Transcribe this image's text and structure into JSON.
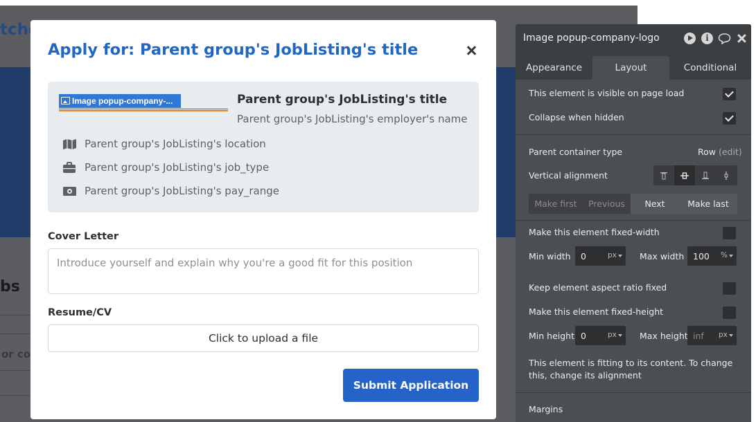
{
  "background": {
    "heading_fragment": "tche",
    "section_fragment": "bs",
    "search_fragment": "or co"
  },
  "modal": {
    "title": "Apply for: Parent group's JobListing's title",
    "logo_element_tag": "Image popup-company-...",
    "job_title": "Parent group's JobListing's title",
    "employer": "Parent group's JobListing's employer's name",
    "details": [
      {
        "icon": "map-icon",
        "text": "Parent group's JobListing's location"
      },
      {
        "icon": "briefcase-icon",
        "text": "Parent group's JobListing's job_type"
      },
      {
        "icon": "money-icon",
        "text": "Parent group's JobListing's pay_range"
      }
    ],
    "cover_letter": {
      "label": "Cover Letter",
      "placeholder": "Introduce yourself and explain why you're a good fit for this position",
      "value": ""
    },
    "resume": {
      "label": "Resume/CV",
      "upload_text": "Click to upload a file"
    },
    "submit_label": "Submit Application"
  },
  "panel": {
    "title": "Image popup-company-logo",
    "tabs": [
      "Appearance",
      "Layout",
      "Conditional"
    ],
    "active_tab": "Layout",
    "visible_on_load": {
      "label": "This element is visible on page load",
      "checked": true
    },
    "collapse_hidden": {
      "label": "Collapse when hidden",
      "checked": true
    },
    "container_type": {
      "label": "Parent container type",
      "value": "Row",
      "edit": "(edit)"
    },
    "vertical_alignment": {
      "label": "Vertical alignment",
      "selected": "center"
    },
    "order_buttons": [
      "Make first",
      "Previous",
      "Next",
      "Make last"
    ],
    "fixed_width": {
      "label": "Make this element fixed-width",
      "checked": false
    },
    "min_width": {
      "label": "Min width",
      "value": "0",
      "unit": "px"
    },
    "max_width": {
      "label": "Max width",
      "value": "100",
      "unit": "%"
    },
    "aspect_ratio": {
      "label": "Keep element aspect ratio fixed",
      "checked": false
    },
    "fixed_height": {
      "label": "Make this element fixed-height",
      "checked": false
    },
    "min_height": {
      "label": "Min height",
      "value": "0",
      "unit": "px"
    },
    "max_height": {
      "label": "Max height",
      "value": "inf",
      "unit": "px"
    },
    "fit_note": "This element is fitting to its content. To change this, change its alignment",
    "margins_label": "Margins"
  },
  "colors": {
    "primary": "#2166c3",
    "submit": "#2563c9",
    "panel_bg": "#4b4e52",
    "panel_header": "#3c3f42",
    "highlight_underline": "#e0821f"
  }
}
